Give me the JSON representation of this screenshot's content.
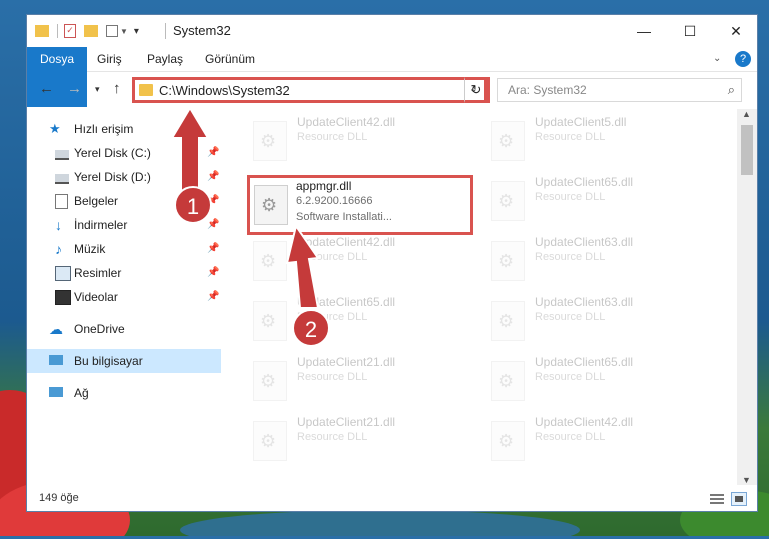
{
  "window": {
    "title": "System32",
    "minimize_icon": "—",
    "maximize_icon": "☐",
    "close_icon": "✕"
  },
  "ribbon": {
    "tabs": [
      "Dosya",
      "Giriş",
      "Paylaş",
      "Görünüm"
    ],
    "help_icon": "?"
  },
  "address": {
    "path": "C:\\Windows\\System32",
    "search_placeholder": "Ara: System32"
  },
  "sidebar": {
    "quick_access": "Hızlı erişim",
    "items": [
      {
        "label": "Yerel Disk (C:)"
      },
      {
        "label": "Yerel Disk (D:)"
      },
      {
        "label": "Belgeler"
      },
      {
        "label": "İndirmeler"
      },
      {
        "label": "Müzik"
      },
      {
        "label": "Resimler"
      },
      {
        "label": "Videolar"
      }
    ],
    "onedrive": "OneDrive",
    "this_pc": "Bu bilgisayar",
    "network": "Ağ"
  },
  "files": [
    {
      "name": "UpdateClient42.dll",
      "sub": "Resource DLL"
    },
    {
      "name": "UpdateClient5.dll",
      "sub": "Resource DLL"
    },
    {
      "name": "appmgr.dll",
      "sub": "6.2.9200.16666",
      "sub2": "Software Installati..."
    },
    {
      "name": "UpdateClient65.dll",
      "sub": "Resource DLL"
    },
    {
      "name": "UpdateClient42.dll",
      "sub": "Resource DLL"
    },
    {
      "name": "UpdateClient63.dll",
      "sub": "Resource DLL"
    },
    {
      "name": "UpdateClient65.dll",
      "sub": "Resource DLL"
    },
    {
      "name": "UpdateClient63.dll",
      "sub": "Resource DLL"
    },
    {
      "name": "UpdateClient21.dll",
      "sub": "Resource DLL"
    },
    {
      "name": "UpdateClient65.dll",
      "sub": "Resource DLL"
    },
    {
      "name": "UpdateClient21.dll",
      "sub": "Resource DLL"
    },
    {
      "name": "UpdateClient42.dll",
      "sub": "Resource DLL"
    }
  ],
  "status": {
    "count": "149 öğe"
  },
  "annotations": {
    "step1": "1",
    "step2": "2"
  },
  "colors": {
    "accent": "#1979ca",
    "annotation_red": "#d9534f",
    "badge_red": "#c53a3a",
    "selected_bg": "#cce8ff"
  }
}
